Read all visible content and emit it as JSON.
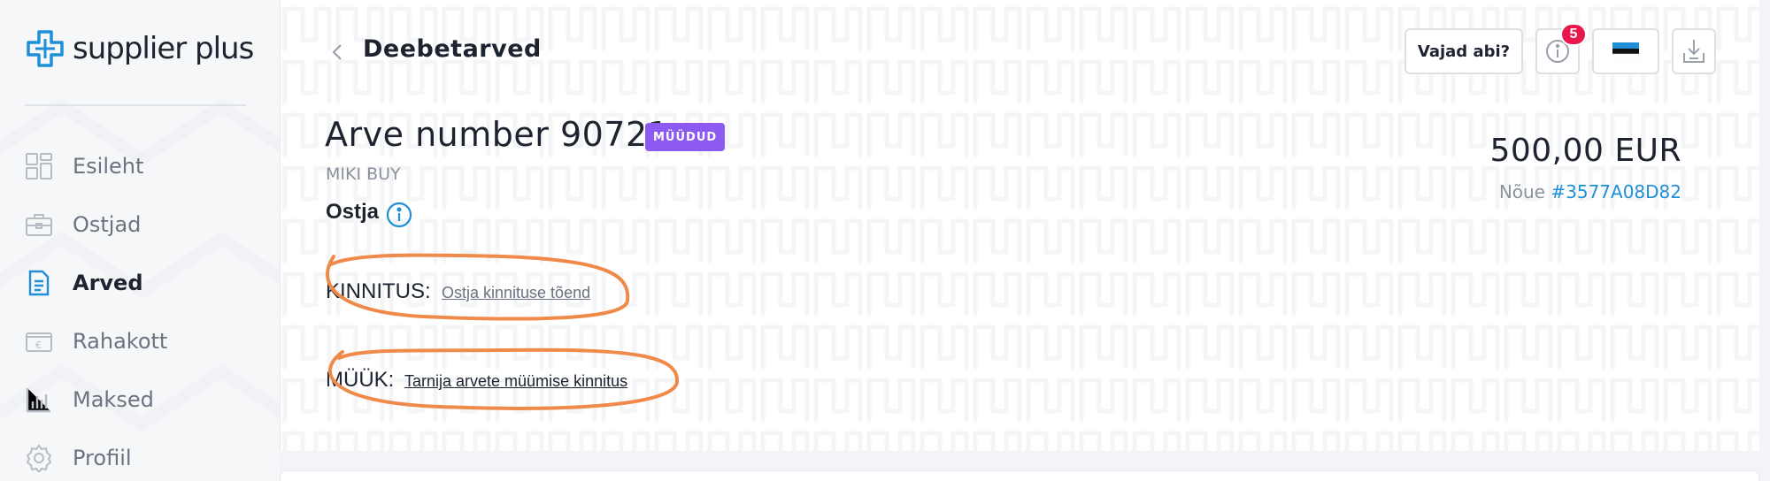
{
  "brand": {
    "name": "supplier plus",
    "accent": "#1f8fd8"
  },
  "sidebar": {
    "items": [
      {
        "label": "Esileht",
        "icon": "dashboard-icon",
        "active": false
      },
      {
        "label": "Ostjad",
        "icon": "briefcase-icon",
        "active": false
      },
      {
        "label": "Arved",
        "icon": "document-icon",
        "active": true
      },
      {
        "label": "Rahakott",
        "icon": "wallet-icon",
        "active": false
      },
      {
        "label": "Maksed",
        "icon": "bar-chart-icon",
        "active": false
      },
      {
        "label": "Profiil",
        "icon": "gear-icon",
        "active": false
      }
    ]
  },
  "header": {
    "back_icon": "chevron-left-icon",
    "title": "Deebetarved",
    "help_label": "Vajad abi?",
    "notifications_count": "5",
    "language_flag": "estonia-flag-icon",
    "download_icon": "download-icon"
  },
  "invoice": {
    "title": "Arve number 90721",
    "status": "MÜÜDUD",
    "status_color": "#8c5af0",
    "buyer": "MIKI BUY",
    "buyer_section_label": "Ostja",
    "amount": "500,00 EUR",
    "claim_prefix": "Nõue",
    "claim_id": "#3577A08D82",
    "confirmation_label": "KINNITUS:",
    "confirmation_link": "Ostja kinnituse tõend",
    "sale_label": "MÜÜK:",
    "sale_link": "Tarnija arvete müümise kinnitus"
  },
  "annotation_color": "#f08a4b"
}
